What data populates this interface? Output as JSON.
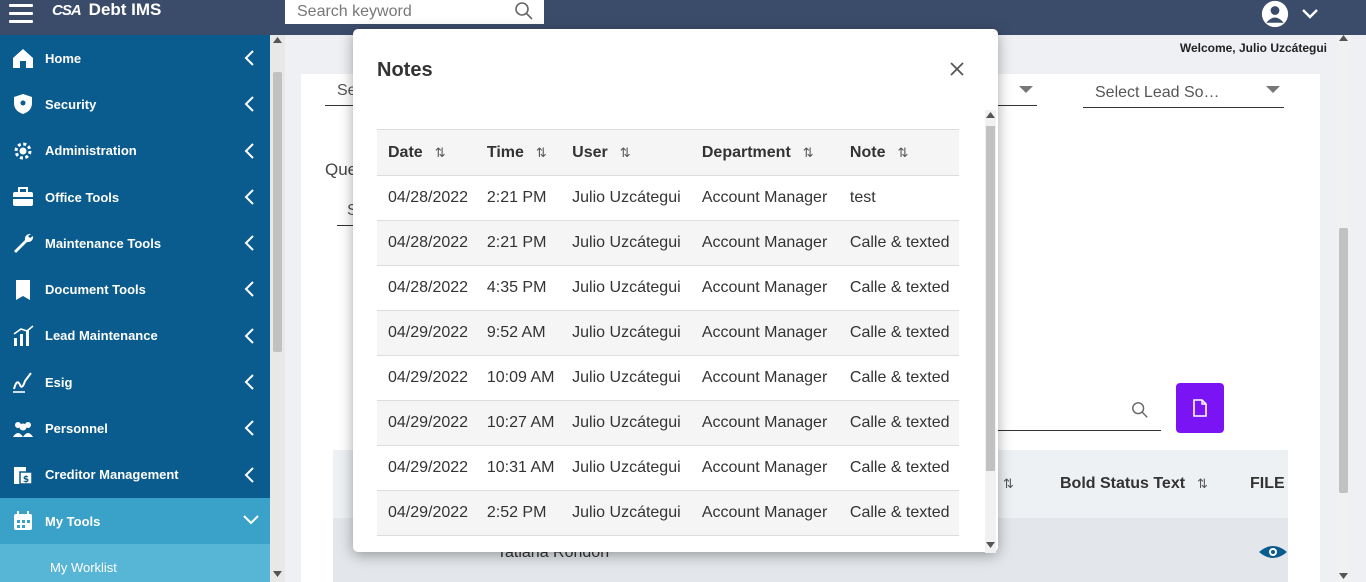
{
  "header": {
    "logo_mark": "CSA",
    "app_title": "Debt IMS",
    "search_placeholder": "Search keyword"
  },
  "welcome": "Welcome, Julio Uzcátegui",
  "sidebar": {
    "items": [
      {
        "label": "Home",
        "icon": "home-icon"
      },
      {
        "label": "Security",
        "icon": "shield-icon"
      },
      {
        "label": "Administration",
        "icon": "gear-icon"
      },
      {
        "label": "Office Tools",
        "icon": "briefcase-icon"
      },
      {
        "label": "Maintenance Tools",
        "icon": "wrench-icon"
      },
      {
        "label": "Document Tools",
        "icon": "book-icon"
      },
      {
        "label": "Lead Maintenance",
        "icon": "chart-icon"
      },
      {
        "label": "Esig",
        "icon": "signature-icon"
      },
      {
        "label": "Personnel",
        "icon": "people-icon"
      },
      {
        "label": "Creditor Management",
        "icon": "creditor-icon"
      },
      {
        "label": "My Tools",
        "icon": "calendar-icon"
      }
    ],
    "sub_items": [
      {
        "label": "My Worklist"
      }
    ]
  },
  "background": {
    "select_1_partial": "Se",
    "select_lead_source": "Select Lead So…",
    "queue_label_partial": "Que",
    "queue_select_partial": "S",
    "grid_headers": [
      "Bold Status Text",
      "FILE"
    ],
    "grid_row_name_partial": "Tatiana Rondon"
  },
  "modal": {
    "title": "Notes",
    "columns": [
      "Date",
      "Time",
      "User",
      "Department",
      "Note"
    ],
    "rows": [
      [
        "04/28/2022",
        "2:21 PM",
        "Julio Uzcátegui",
        "Account Manager",
        "test"
      ],
      [
        "04/28/2022",
        "2:21 PM",
        "Julio Uzcátegui",
        "Account Manager",
        "Calle & texted"
      ],
      [
        "04/28/2022",
        "4:35 PM",
        "Julio Uzcátegui",
        "Account Manager",
        "Calle & texted"
      ],
      [
        "04/29/2022",
        "9:52 AM",
        "Julio Uzcátegui",
        "Account Manager",
        "Calle & texted"
      ],
      [
        "04/29/2022",
        "10:09 AM",
        "Julio Uzcátegui",
        "Account Manager",
        "Calle & texted"
      ],
      [
        "04/29/2022",
        "10:27 AM",
        "Julio Uzcátegui",
        "Account Manager",
        "Calle & texted"
      ],
      [
        "04/29/2022",
        "10:31 AM",
        "Julio Uzcátegui",
        "Account Manager",
        "Calle & texted"
      ],
      [
        "04/29/2022",
        "2:52 PM",
        "Julio Uzcátegui",
        "Account Manager",
        "Calle & texted"
      ]
    ]
  },
  "colors": {
    "topbar": "#3b4c6b",
    "sidebar": "#0a5b8e",
    "sidebar_active": "#3aa1c9",
    "accent_button": "#7a14f5"
  }
}
